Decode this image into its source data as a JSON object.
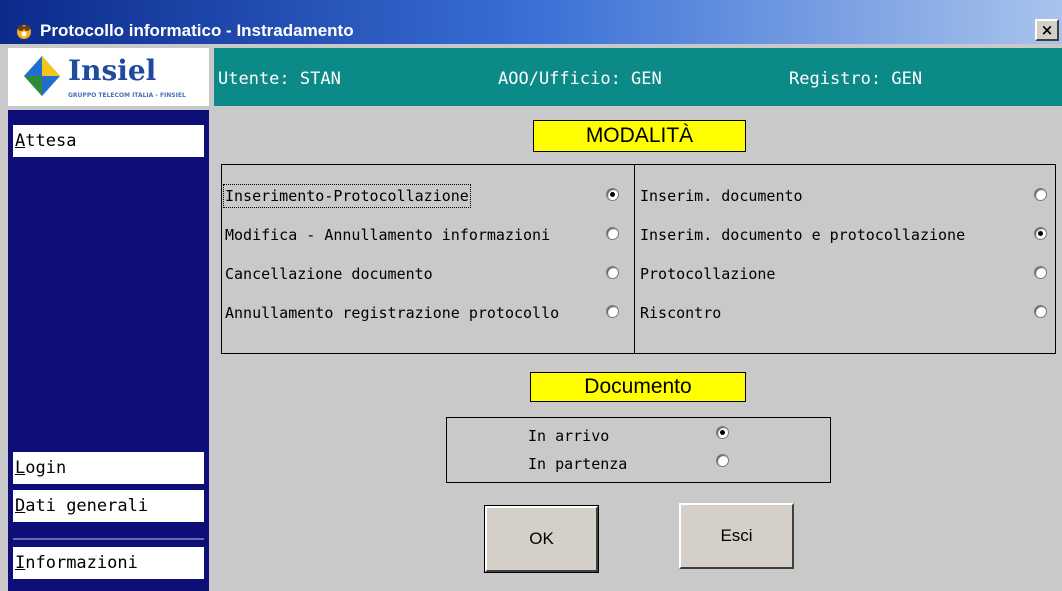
{
  "window": {
    "title": "Protocollo informatico - Instradamento",
    "close_label": "×"
  },
  "logo": {
    "name": "Insiel",
    "tagline": "GRUPPO TELECOM ITALIA - FINSIEL"
  },
  "header": {
    "user": "Utente: STAN",
    "office": "AOO/Ufficio: GEN",
    "registry": "Registro: GEN"
  },
  "sidebar": {
    "items": [
      {
        "label": "Attesa",
        "underline": "A"
      },
      {
        "label": "Login",
        "underline": "L"
      },
      {
        "label": "Dati generali",
        "underline": "D"
      },
      {
        "label": "Informazioni",
        "underline": "I"
      }
    ]
  },
  "modalita": {
    "title": "MODALITÀ",
    "left_options": [
      {
        "label": "Inserimento-Protocollazione",
        "checked": true
      },
      {
        "label": "Modifica - Annullamento informazioni",
        "checked": false
      },
      {
        "label": "Cancellazione documento",
        "checked": false
      },
      {
        "label": "Annullamento registrazione protocollo",
        "checked": false
      }
    ],
    "right_options": [
      {
        "label": "Inserim. documento",
        "checked": false
      },
      {
        "label": "Inserim. documento e protocollazione",
        "checked": true
      },
      {
        "label": "Protocollazione",
        "checked": false
      },
      {
        "label": "Riscontro",
        "checked": false
      }
    ]
  },
  "documento": {
    "title": "Documento",
    "options": [
      {
        "label": "In arrivo",
        "checked": true
      },
      {
        "label": "In partenza",
        "checked": false
      }
    ]
  },
  "buttons": {
    "ok": "OK",
    "esci": "Esci"
  },
  "colors": {
    "title_bar_start": "#0b2a8c",
    "header_teal": "#0b8a87",
    "sidebar_navy": "#0e0e78",
    "section_label_yellow": "#ffff00",
    "background_gray": "#c9c9c9"
  }
}
